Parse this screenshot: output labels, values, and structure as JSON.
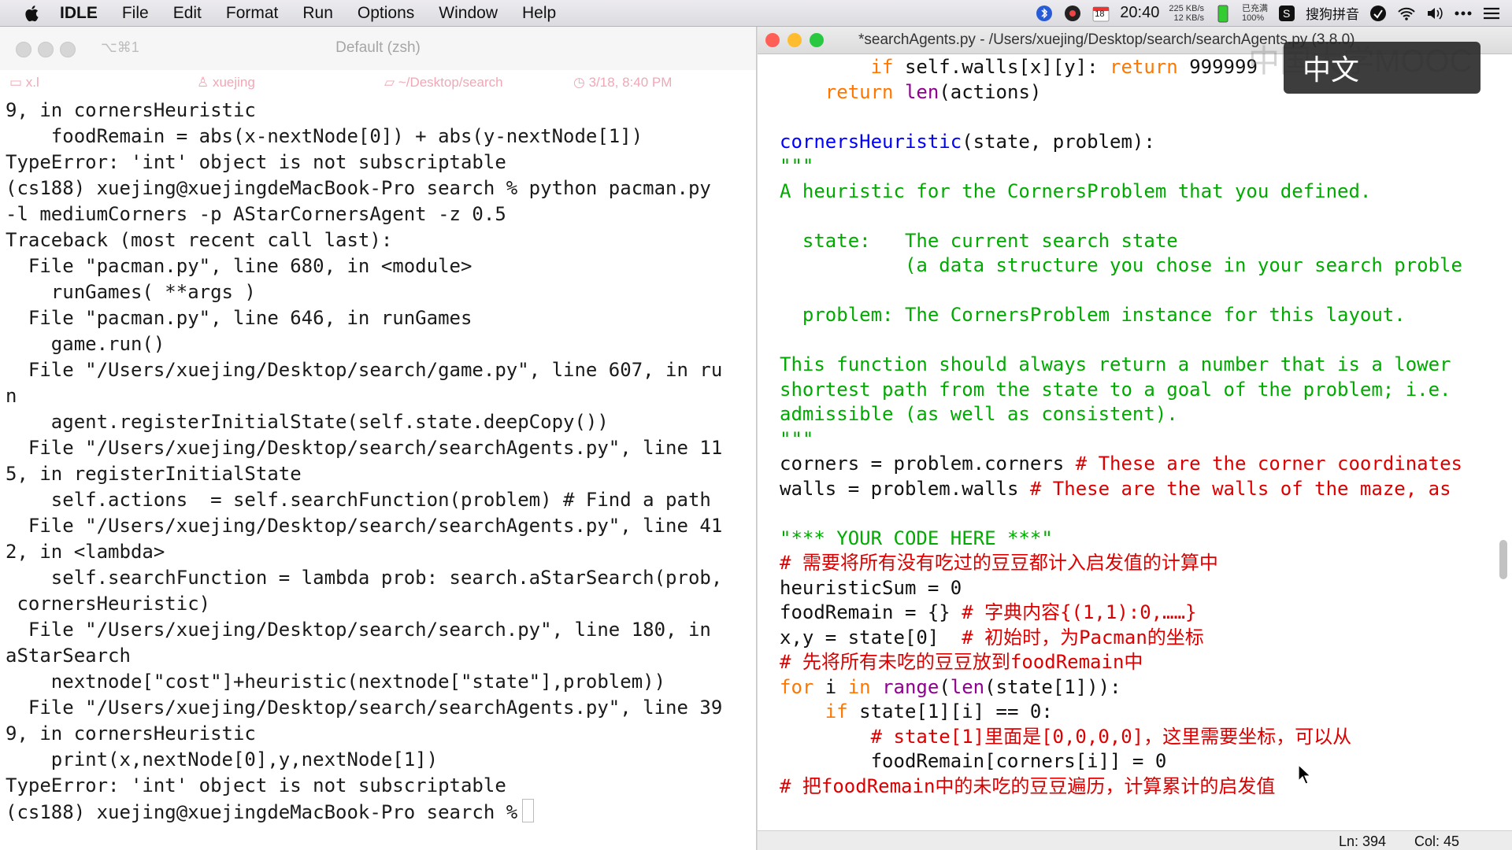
{
  "menubar": {
    "app": "IDLE",
    "items": [
      "File",
      "Edit",
      "Format",
      "Run",
      "Options",
      "Window",
      "Help"
    ],
    "clock": "20:40",
    "calendar_day": "18",
    "net_up": "225 KB/s",
    "net_down": "12 KB/s",
    "battery_label": "已充满",
    "battery_percent": "100%",
    "ime": "搜狗拼音"
  },
  "terminal": {
    "title": "Default (zsh)",
    "shortcut": "⌥⌘1",
    "status": {
      "host": "x.l",
      "user": "xuejing",
      "path": "~/Desktop/search",
      "time": "3/18, 8:40 PM"
    },
    "lines": [
      "9, in cornersHeuristic",
      "    foodRemain = abs(x-nextNode[0]) + abs(y-nextNode[1])",
      "TypeError: 'int' object is not subscriptable",
      "(cs188) xuejing@xuejingdeMacBook-Pro search % python pacman.py",
      "-l mediumCorners -p AStarCornersAgent -z 0.5",
      "Traceback (most recent call last):",
      "  File \"pacman.py\", line 680, in <module>",
      "    runGames( **args )",
      "  File \"pacman.py\", line 646, in runGames",
      "    game.run()",
      "  File \"/Users/xuejing/Desktop/search/game.py\", line 607, in ru",
      "n",
      "    agent.registerInitialState(self.state.deepCopy())",
      "  File \"/Users/xuejing/Desktop/search/searchAgents.py\", line 11",
      "5, in registerInitialState",
      "    self.actions  = self.searchFunction(problem) # Find a path",
      "  File \"/Users/xuejing/Desktop/search/searchAgents.py\", line 41",
      "2, in <lambda>",
      "    self.searchFunction = lambda prob: search.aStarSearch(prob,",
      " cornersHeuristic)",
      "  File \"/Users/xuejing/Desktop/search/search.py\", line 180, in",
      "aStarSearch",
      "    nextnode[\"cost\"]+heuristic(nextnode[\"state\"],problem))",
      "  File \"/Users/xuejing/Desktop/search/searchAgents.py\", line 39",
      "9, in cornersHeuristic",
      "    print(x,nextNode[0],y,nextNode[1])",
      "TypeError: 'int' object is not subscriptable"
    ],
    "prompt": "(cs188) xuejing@xuejingdeMacBook-Pro search %"
  },
  "editor": {
    "title": "*searchAgents.py - /Users/xuejing/Desktop/search/searchAgents.py (3.8.0)",
    "status": {
      "line": "Ln: 394",
      "col": "Col: 45"
    },
    "code": {
      "l1_kw": "if",
      "l1_rest": " self.walls[x][y]: ",
      "l1_kw2": "return",
      "l1_num": " 999999",
      "l2_kw": "return",
      "l2_bi": "len",
      "l2_rest": "(actions)",
      "def_name": "cornersHeuristic",
      "def_args": "(state, problem):",
      "doc_open": "\"\"\"",
      "doc1": "A heuristic for the CornersProblem that you defined.",
      "doc2": "  state:   The current search state",
      "doc3": "           (a data structure you chose in your search proble",
      "doc4": "  problem: The CornersProblem instance for this layout.",
      "doc5": "This function should always return a number that is a lower",
      "doc6": "shortest path from the state to a goal of the problem; i.e.",
      "doc7": "admissible (as well as consistent).",
      "doc_close": "\"\"\"",
      "corners_code": "corners = problem.corners ",
      "corners_cm": "# These are the corner coordinates",
      "walls_code": "walls = problem.walls ",
      "walls_cm": "# These are the walls of the maze, as",
      "your_code": "\"*** YOUR CODE HERE ***\"",
      "cm1": "# 需要将所有没有吃过的豆豆都计入启发值的计算中",
      "hsum": "heuristicSum = 0",
      "food_code": "foodRemain = {} ",
      "food_cm": "# 字典内容{(1,1):0,……}",
      "xy_code": "x,y = state[0]  ",
      "xy_cm": "# 初始时，为Pacman的坐标",
      "cm2": "# 先将所有未吃的豆豆放到foodRemain中",
      "for_kw": "for",
      "for_v": " i ",
      "for_in": "in",
      "for_range": "range",
      "for_p1": "(",
      "for_len": "len",
      "for_rest": "(state[1])):",
      "if2_kw": "if",
      "if2_rest": " state[1][i] == 0:",
      "cm3": "# state[1]里面是[0,0,0,0]，这里需要坐标，可以从",
      "assign": "foodRemain[corners[i]] = 0",
      "cm4": "# 把foodRemain中的未吃的豆豆遍历，计算累计的启发值"
    }
  },
  "overlay": {
    "subtitle": "中文",
    "watermark": "中国大学MOOC"
  }
}
